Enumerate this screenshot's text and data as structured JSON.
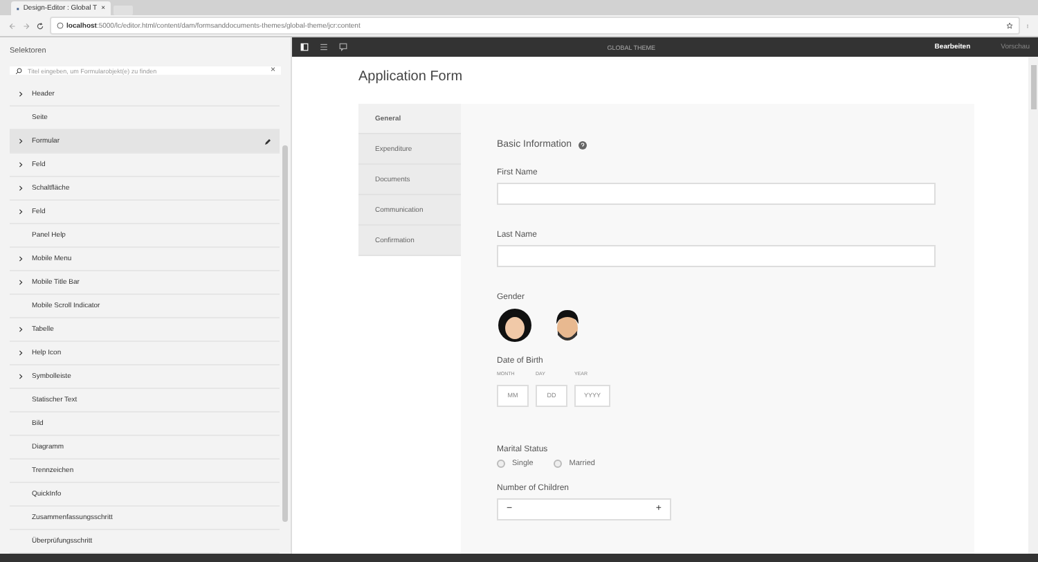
{
  "browser": {
    "tab_title": "Design-Editor : Global T",
    "tab_close": "×",
    "url_host": "localhost",
    "url_path": ":5000/lc/editor.html/content/dam/formsanddocuments-themes/global-theme/jcr:content"
  },
  "sidebar": {
    "title": "Selektoren",
    "search": {
      "placeholder": "Titel eingeben, um Formularobjekt(e) zu finden",
      "clear": "×"
    },
    "items": [
      {
        "label": "Header",
        "expandable": true,
        "selected": false
      },
      {
        "label": "Seite",
        "expandable": false,
        "selected": false
      },
      {
        "label": "Formular",
        "expandable": true,
        "selected": true
      },
      {
        "label": "Feld",
        "expandable": true,
        "selected": false
      },
      {
        "label": "Schaltfläche",
        "expandable": true,
        "selected": false
      },
      {
        "label": "Feld",
        "expandable": true,
        "selected": false
      },
      {
        "label": "Panel Help",
        "expandable": false,
        "selected": false
      },
      {
        "label": "Mobile Menu",
        "expandable": true,
        "selected": false
      },
      {
        "label": "Mobile Title Bar",
        "expandable": true,
        "selected": false
      },
      {
        "label": "Mobile Scroll Indicator",
        "expandable": false,
        "selected": false
      },
      {
        "label": "Tabelle",
        "expandable": true,
        "selected": false
      },
      {
        "label": "Help Icon",
        "expandable": true,
        "selected": false
      },
      {
        "label": "Symbolleiste",
        "expandable": true,
        "selected": false
      },
      {
        "label": "Statischer Text",
        "expandable": false,
        "selected": false
      },
      {
        "label": "Bild",
        "expandable": false,
        "selected": false
      },
      {
        "label": "Diagramm",
        "expandable": false,
        "selected": false
      },
      {
        "label": "Trennzeichen",
        "expandable": false,
        "selected": false
      },
      {
        "label": "QuickInfo",
        "expandable": false,
        "selected": false
      },
      {
        "label": "Zusammenfassungsschritt",
        "expandable": false,
        "selected": false
      },
      {
        "label": "Überprüfungsschritt",
        "expandable": false,
        "selected": false
      }
    ]
  },
  "toolbar": {
    "title": "GLOBAL THEME",
    "modes": [
      {
        "label": "Bearbeiten",
        "selected": true
      },
      {
        "label": "Vorschau",
        "selected": false
      }
    ]
  },
  "form": {
    "title": "Application Form",
    "tabs": [
      {
        "label": "General",
        "selected": true
      },
      {
        "label": "Expenditure",
        "selected": false
      },
      {
        "label": "Documents",
        "selected": false
      },
      {
        "label": "Communication",
        "selected": false
      },
      {
        "label": "Confirmation",
        "selected": false
      }
    ],
    "section": "Basic Information",
    "first_name": {
      "label": "First Name"
    },
    "last_name": {
      "label": "Last Name"
    },
    "gender": {
      "label": "Gender",
      "options": [
        {
          "kind": "female",
          "selected": false
        },
        {
          "kind": "male",
          "selected": false
        }
      ]
    },
    "dob": {
      "label": "Date of Birth",
      "parts": [
        {
          "caption": "MONTH",
          "placeholder": "MM"
        },
        {
          "caption": "DAY",
          "placeholder": "DD"
        },
        {
          "caption": "YEAR",
          "placeholder": "YYYY"
        }
      ]
    },
    "marital": {
      "label": "Marital Status",
      "options": [
        {
          "label": "Single",
          "selected": false
        },
        {
          "label": "Married",
          "selected": false
        }
      ]
    },
    "children": {
      "label": "Number of Children",
      "minus": "−",
      "plus": "+"
    }
  }
}
